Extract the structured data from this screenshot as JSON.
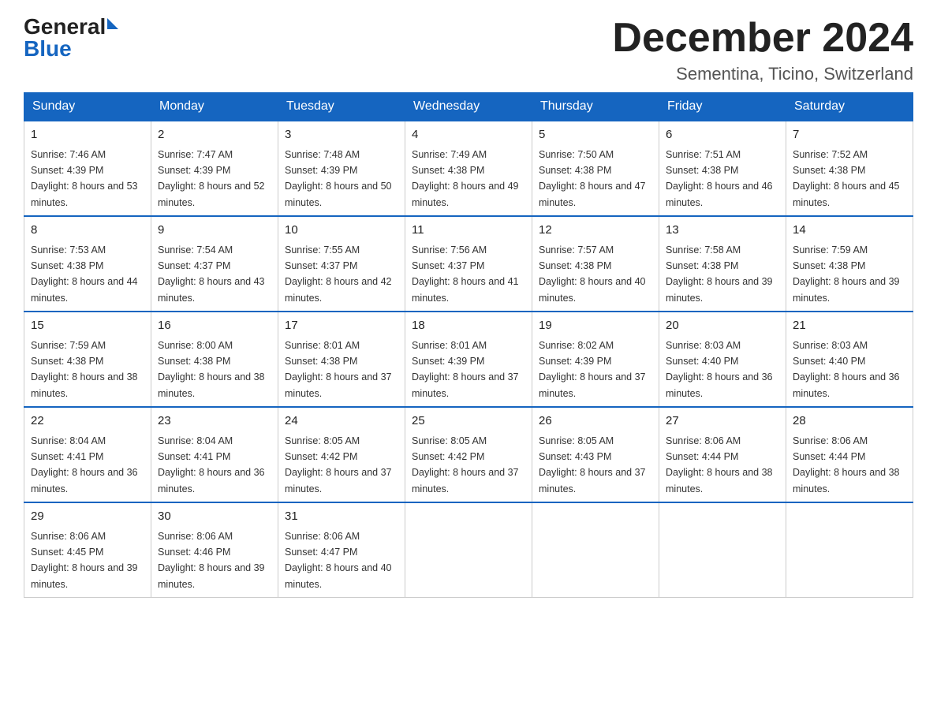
{
  "header": {
    "logo_general": "General",
    "logo_blue": "Blue",
    "month_title": "December 2024",
    "subtitle": "Sementina, Ticino, Switzerland"
  },
  "weekdays": [
    "Sunday",
    "Monday",
    "Tuesday",
    "Wednesday",
    "Thursday",
    "Friday",
    "Saturday"
  ],
  "weeks": [
    [
      {
        "day": "1",
        "sunrise": "7:46 AM",
        "sunset": "4:39 PM",
        "daylight": "8 hours and 53 minutes."
      },
      {
        "day": "2",
        "sunrise": "7:47 AM",
        "sunset": "4:39 PM",
        "daylight": "8 hours and 52 minutes."
      },
      {
        "day": "3",
        "sunrise": "7:48 AM",
        "sunset": "4:39 PM",
        "daylight": "8 hours and 50 minutes."
      },
      {
        "day": "4",
        "sunrise": "7:49 AM",
        "sunset": "4:38 PM",
        "daylight": "8 hours and 49 minutes."
      },
      {
        "day": "5",
        "sunrise": "7:50 AM",
        "sunset": "4:38 PM",
        "daylight": "8 hours and 47 minutes."
      },
      {
        "day": "6",
        "sunrise": "7:51 AM",
        "sunset": "4:38 PM",
        "daylight": "8 hours and 46 minutes."
      },
      {
        "day": "7",
        "sunrise": "7:52 AM",
        "sunset": "4:38 PM",
        "daylight": "8 hours and 45 minutes."
      }
    ],
    [
      {
        "day": "8",
        "sunrise": "7:53 AM",
        "sunset": "4:38 PM",
        "daylight": "8 hours and 44 minutes."
      },
      {
        "day": "9",
        "sunrise": "7:54 AM",
        "sunset": "4:37 PM",
        "daylight": "8 hours and 43 minutes."
      },
      {
        "day": "10",
        "sunrise": "7:55 AM",
        "sunset": "4:37 PM",
        "daylight": "8 hours and 42 minutes."
      },
      {
        "day": "11",
        "sunrise": "7:56 AM",
        "sunset": "4:37 PM",
        "daylight": "8 hours and 41 minutes."
      },
      {
        "day": "12",
        "sunrise": "7:57 AM",
        "sunset": "4:38 PM",
        "daylight": "8 hours and 40 minutes."
      },
      {
        "day": "13",
        "sunrise": "7:58 AM",
        "sunset": "4:38 PM",
        "daylight": "8 hours and 39 minutes."
      },
      {
        "day": "14",
        "sunrise": "7:59 AM",
        "sunset": "4:38 PM",
        "daylight": "8 hours and 39 minutes."
      }
    ],
    [
      {
        "day": "15",
        "sunrise": "7:59 AM",
        "sunset": "4:38 PM",
        "daylight": "8 hours and 38 minutes."
      },
      {
        "day": "16",
        "sunrise": "8:00 AM",
        "sunset": "4:38 PM",
        "daylight": "8 hours and 38 minutes."
      },
      {
        "day": "17",
        "sunrise": "8:01 AM",
        "sunset": "4:38 PM",
        "daylight": "8 hours and 37 minutes."
      },
      {
        "day": "18",
        "sunrise": "8:01 AM",
        "sunset": "4:39 PM",
        "daylight": "8 hours and 37 minutes."
      },
      {
        "day": "19",
        "sunrise": "8:02 AM",
        "sunset": "4:39 PM",
        "daylight": "8 hours and 37 minutes."
      },
      {
        "day": "20",
        "sunrise": "8:03 AM",
        "sunset": "4:40 PM",
        "daylight": "8 hours and 36 minutes."
      },
      {
        "day": "21",
        "sunrise": "8:03 AM",
        "sunset": "4:40 PM",
        "daylight": "8 hours and 36 minutes."
      }
    ],
    [
      {
        "day": "22",
        "sunrise": "8:04 AM",
        "sunset": "4:41 PM",
        "daylight": "8 hours and 36 minutes."
      },
      {
        "day": "23",
        "sunrise": "8:04 AM",
        "sunset": "4:41 PM",
        "daylight": "8 hours and 36 minutes."
      },
      {
        "day": "24",
        "sunrise": "8:05 AM",
        "sunset": "4:42 PM",
        "daylight": "8 hours and 37 minutes."
      },
      {
        "day": "25",
        "sunrise": "8:05 AM",
        "sunset": "4:42 PM",
        "daylight": "8 hours and 37 minutes."
      },
      {
        "day": "26",
        "sunrise": "8:05 AM",
        "sunset": "4:43 PM",
        "daylight": "8 hours and 37 minutes."
      },
      {
        "day": "27",
        "sunrise": "8:06 AM",
        "sunset": "4:44 PM",
        "daylight": "8 hours and 38 minutes."
      },
      {
        "day": "28",
        "sunrise": "8:06 AM",
        "sunset": "4:44 PM",
        "daylight": "8 hours and 38 minutes."
      }
    ],
    [
      {
        "day": "29",
        "sunrise": "8:06 AM",
        "sunset": "4:45 PM",
        "daylight": "8 hours and 39 minutes."
      },
      {
        "day": "30",
        "sunrise": "8:06 AM",
        "sunset": "4:46 PM",
        "daylight": "8 hours and 39 minutes."
      },
      {
        "day": "31",
        "sunrise": "8:06 AM",
        "sunset": "4:47 PM",
        "daylight": "8 hours and 40 minutes."
      },
      null,
      null,
      null,
      null
    ]
  ]
}
